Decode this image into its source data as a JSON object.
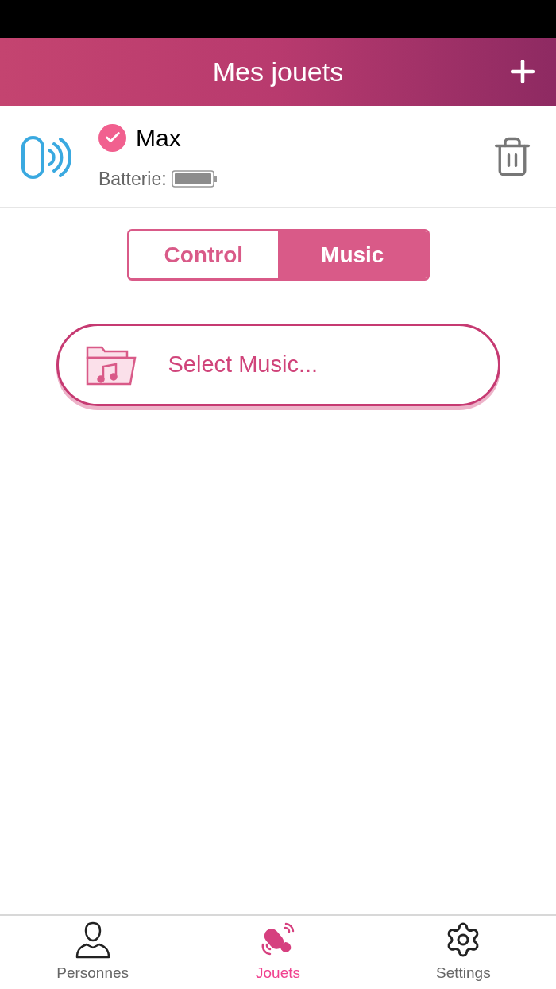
{
  "header": {
    "title": "Mes jouets"
  },
  "device": {
    "name": "Max",
    "connected": true,
    "battery_label": "Batterie:"
  },
  "tabs": [
    {
      "label": "Control",
      "selected": false
    },
    {
      "label": "Music",
      "selected": true
    }
  ],
  "select_music": {
    "label": "Select Music..."
  },
  "bottom_nav": [
    {
      "kind": "person",
      "label": "Personnes",
      "selected": false
    },
    {
      "kind": "toy",
      "label": "Jouets",
      "selected": true
    },
    {
      "kind": "settings",
      "label": "Settings",
      "selected": false
    }
  ]
}
